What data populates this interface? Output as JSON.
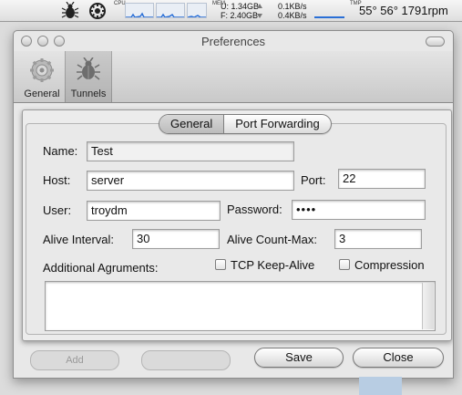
{
  "menubar": {
    "cpu_label": "CPU",
    "mem_label": "MEM",
    "mem_used": "U:  1.34GB",
    "mem_free": "F:  2.40GB",
    "net_down": "0.1KB/s",
    "net_up": "0.4KB/s",
    "tmp_label": "TMP",
    "temps": "55° 56° 1791rpm"
  },
  "window": {
    "title": "Preferences"
  },
  "toolbar": {
    "items": [
      {
        "label": "General",
        "icon": "gear-icon",
        "selected": false
      },
      {
        "label": "Tunnels",
        "icon": "bug-icon",
        "selected": true
      }
    ]
  },
  "tabs": {
    "general": "General",
    "port_forwarding": "Port Forwarding",
    "selected": "General"
  },
  "form": {
    "name_label": "Name:",
    "name_value": "Test",
    "host_label": "Host:",
    "host_value": "server",
    "port_label": "Port:",
    "port_value": "22",
    "user_label": "User:",
    "user_value": "troydm",
    "password_label": "Password:",
    "password_value": "••••",
    "alive_interval_label": "Alive Interval:",
    "alive_interval_value": "30",
    "alive_countmax_label": "Alive Count-Max:",
    "alive_countmax_value": "3",
    "additional_label": "Additional Agruments:",
    "tcp_keepalive_label": "TCP Keep-Alive",
    "tcp_keepalive_checked": false,
    "compression_label": "Compression",
    "compression_checked": false,
    "additional_value": ""
  },
  "buttons": {
    "save": "Save",
    "close": "Close"
  },
  "background": {
    "add_button": "Add"
  },
  "colors": {
    "graph_blue": "#2a6fd6",
    "selected_tab": "#c4c4c4"
  }
}
